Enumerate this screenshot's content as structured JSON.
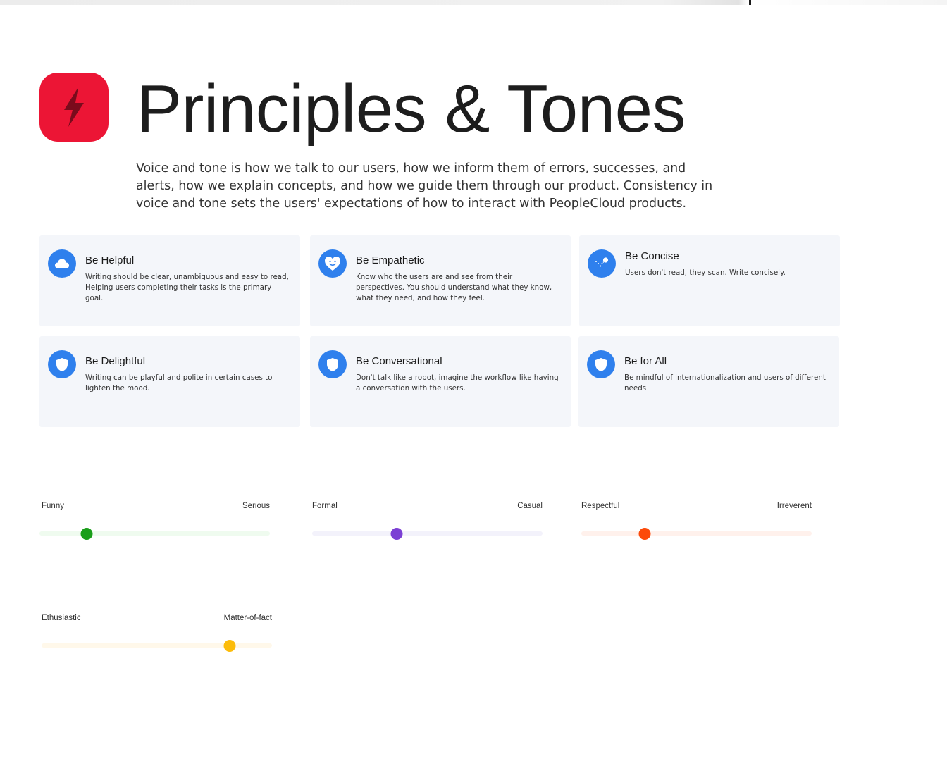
{
  "header": {
    "title": "Principles & Tones",
    "icon": "lightning-icon",
    "icon_color": "#ec1535",
    "intro": "Voice and tone is how we talk to our users, how we inform them of errors, successes, and alerts, how we explain concepts, and how we guide them through our product. Consistency in voice and tone sets the users' expectations of how to interact with PeopleCloud products."
  },
  "principles": [
    {
      "title": "Be Helpful",
      "description": "Writing should be clear, unambiguous and easy to read, Helping users completing their tasks is the primary goal.",
      "icon": "cloud-icon"
    },
    {
      "title": "Be Empathetic",
      "description": "Know who the users are and see from their perspectives. You should understand what they know, what they need, and how they feel.",
      "icon": "heart-smile-icon"
    },
    {
      "title": "Be Concise",
      "description": "Users don't read, they scan. Write concisely.",
      "icon": "scatter-dots-icon"
    },
    {
      "title": "Be Delightful",
      "description": "Writing can be playful and polite in certain cases to lighten the mood.",
      "icon": "shield-icon"
    },
    {
      "title": "Be Conversational",
      "description": "Don't talk like a robot, imagine the workflow like having a conversation with the users.",
      "icon": "shield-icon"
    },
    {
      "title": "Be for All",
      "description": "Be mindful of internationalization and users of different needs",
      "icon": "shield-icon"
    }
  ],
  "tones": [
    {
      "left": "Funny",
      "right": "Serious",
      "value": 0.205,
      "color": "#1a9e1a",
      "track_color": "#effbef"
    },
    {
      "left": "Formal",
      "right": "Casual",
      "value": 0.368,
      "color": "#7b3fd4",
      "track_color": "#f3f2fb"
    },
    {
      "left": "Respectful",
      "right": "Irreverent",
      "value": 0.275,
      "color": "#fc4a0a",
      "track_color": "#fff1ec"
    },
    {
      "left": "Ethusiastic",
      "right": "Matter-of-fact",
      "value": 0.818,
      "color": "#fcbc0a",
      "track_color": "#fff8ea"
    }
  ],
  "colors": {
    "card_icon_bg": "#2f80ed",
    "card_bg": "#f4f6fa"
  }
}
